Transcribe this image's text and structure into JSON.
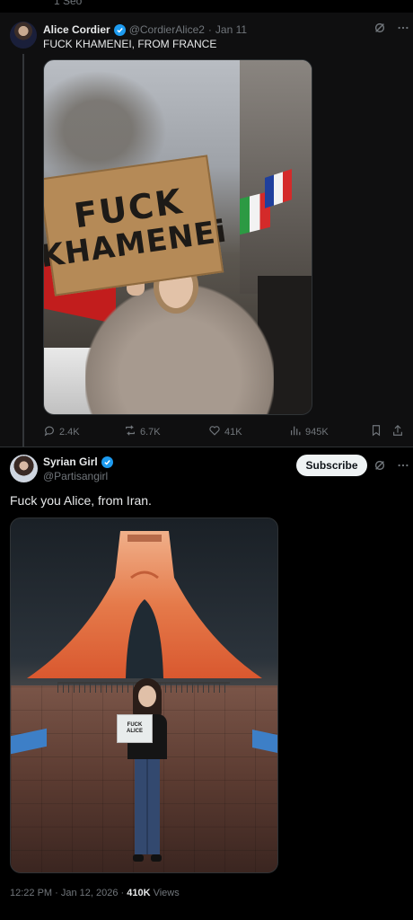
{
  "top_strip": {
    "ghost_text": "1 Seo"
  },
  "quoted_tweet": {
    "author_name": "Alice Cordier",
    "handle": "@CordierAlice2",
    "separator": "·",
    "date": "Jan 11",
    "text": "FUCK KHAMENEI, FROM FRANCE",
    "media": {
      "sign_line1": "FUCK",
      "sign_line2": "KHAMENEi"
    },
    "actions": {
      "replies": "2.4K",
      "reposts": "6.7K",
      "likes": "41K",
      "views": "945K"
    }
  },
  "main_tweet": {
    "author_name": "Syrian Girl",
    "handle": "@Partisangirl",
    "subscribe_label": "Subscribe",
    "text": "Fuck you Alice, from Iran.",
    "media": {
      "sign_line1": "FUCK",
      "sign_line2": "ALICE"
    },
    "footer": {
      "timestamp": "12:22 PM · Jan 12, 2026 · ",
      "views_count": "410K",
      "views_label": " Views"
    }
  },
  "colors": {
    "background": "#000000",
    "accent_blue": "#1d9bf0",
    "muted_text": "#71767b",
    "text": "#e7e9ea"
  },
  "icons": [
    "verified-badge-icon",
    "grok-icon",
    "more-icon",
    "reply-icon",
    "repost-icon",
    "like-icon",
    "views-icon",
    "bookmark-icon",
    "share-icon"
  ]
}
